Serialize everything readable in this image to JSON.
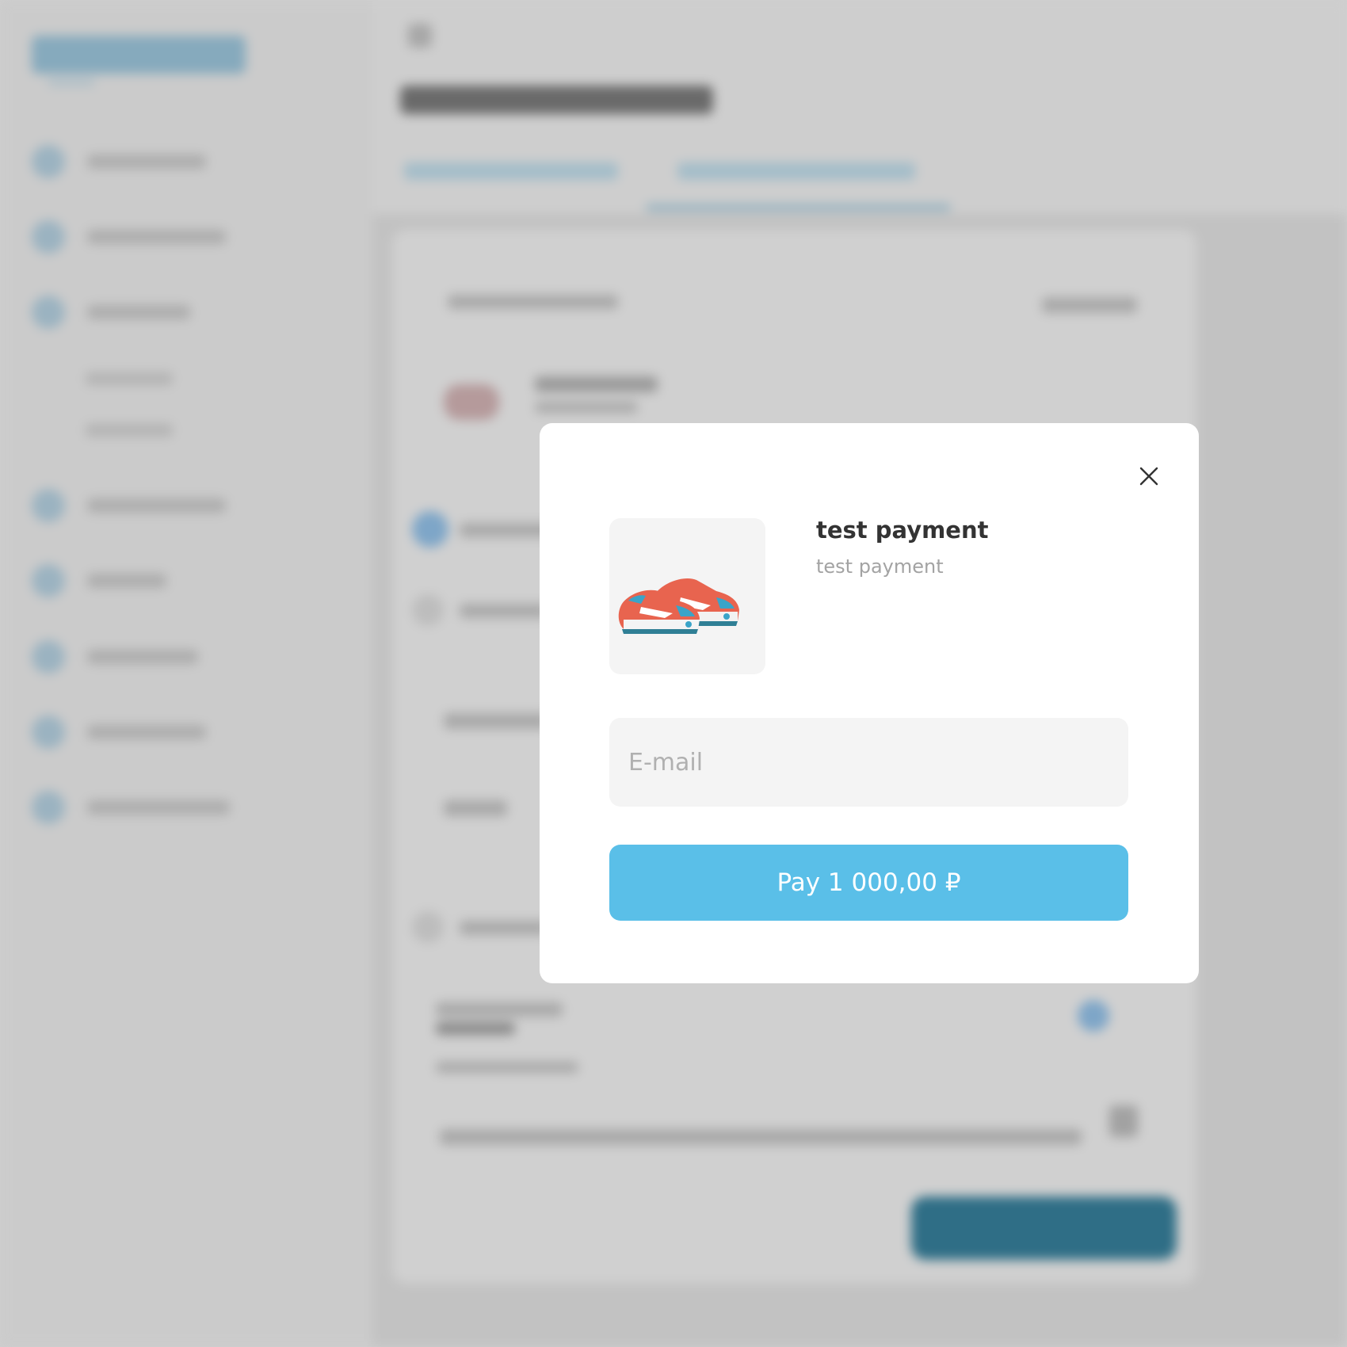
{
  "modal": {
    "product": {
      "title": "test payment",
      "description": "test payment"
    },
    "email": {
      "placeholder": "E-mail",
      "value": ""
    },
    "pay_button": {
      "label": "Pay 1 000,00 ₽"
    },
    "icons": {
      "close": "close-icon",
      "product_image": "sneakers-image"
    }
  },
  "colors": {
    "accent": "#5abfe8",
    "modal_bg": "#ffffff",
    "input_bg": "#f4f4f4",
    "overlay": "#cdcdcd",
    "title": "#333333",
    "muted": "#a3a3a3"
  }
}
